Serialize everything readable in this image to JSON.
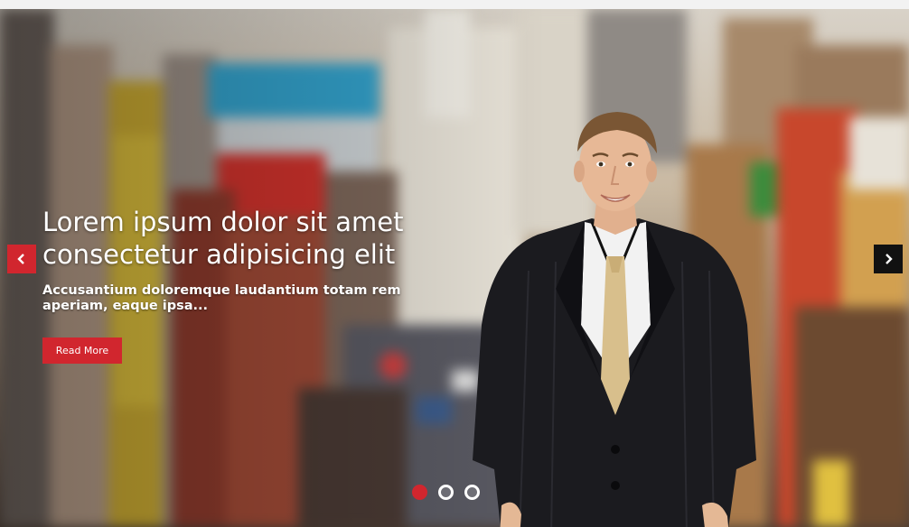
{
  "slide": {
    "headline": "Lorem ipsum dolor sit amet consectetur adipisicing elit",
    "subtext": "Accusantium doloremque laudantium totam rem aperiam, eaque ipsa...",
    "button_label": "Read More"
  },
  "controls": {
    "prev_icon": "chevron-left-icon",
    "next_icon": "chevron-right-icon"
  },
  "pagination": {
    "total": 3,
    "active_index": 0
  },
  "colors": {
    "accent": "#d1262e",
    "next_arrow": "#111111",
    "text": "#ffffff"
  }
}
